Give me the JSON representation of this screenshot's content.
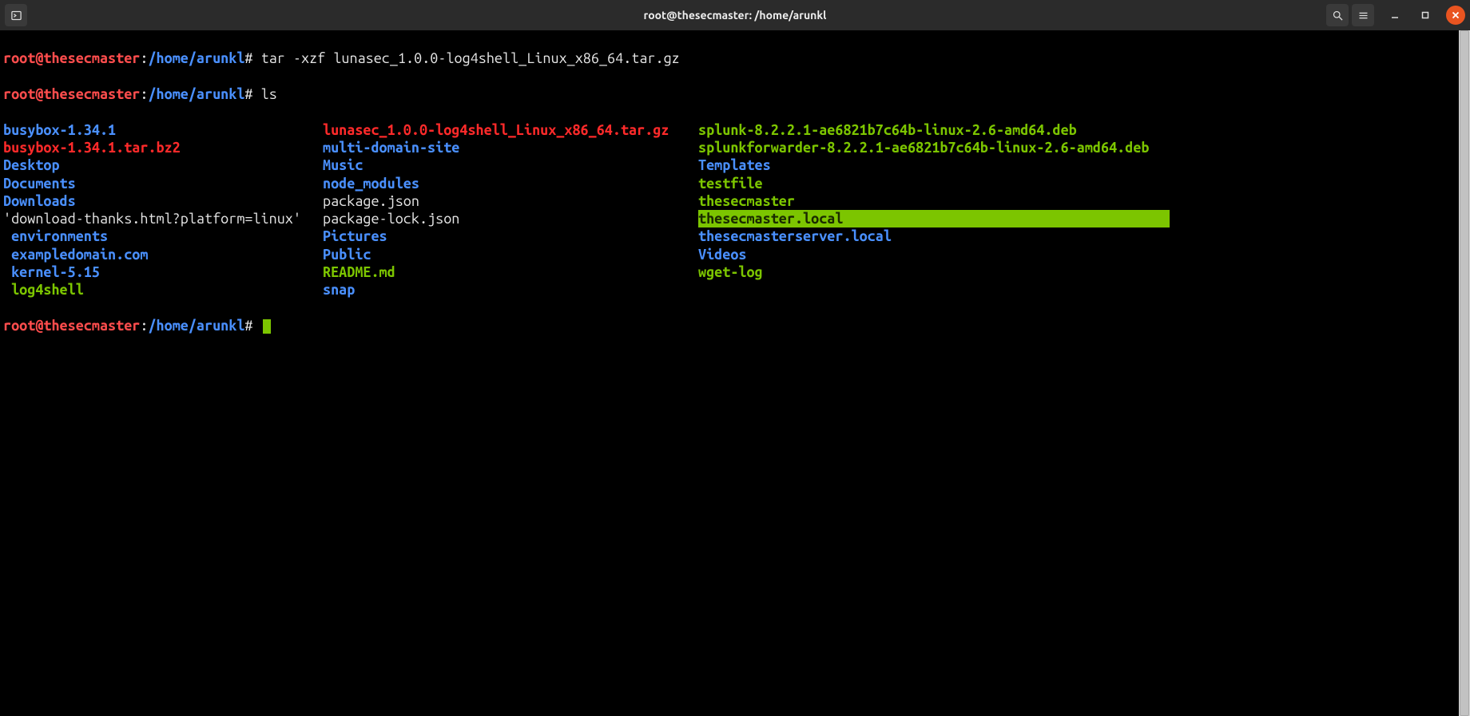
{
  "window": {
    "title": "root@thesecmaster: /home/arunkl"
  },
  "colors": {
    "prompt_user": "#ff4d4d",
    "prompt_path": "#4a90ff",
    "directory": "#4a90ff",
    "executable": "#7cc500",
    "archive": "#ff2a2a",
    "highlight_bg": "#7cc500",
    "close_btn": "#e95420",
    "titlebar_bg": "#2b2b2b",
    "terminal_bg": "#000000"
  },
  "prompt": {
    "user_host": "root@thesecmaster",
    "path": "/home/arunkl",
    "sep1": ":",
    "sigil": "#"
  },
  "history": [
    {
      "cmd": "tar -xzf lunasec_1.0.0-log4shell_Linux_x86_64.tar.gz"
    },
    {
      "cmd": "ls"
    }
  ],
  "ls": {
    "col1": [
      {
        "text": "busybox-1.34.1",
        "class": "dir"
      },
      {
        "text": "busybox-1.34.1.tar.bz2",
        "class": "arch"
      },
      {
        "text": "Desktop",
        "class": "dir"
      },
      {
        "text": "Documents",
        "class": "dir"
      },
      {
        "text": "Downloads",
        "class": "dir"
      },
      {
        "text": "'download-thanks.html?platform=linux'",
        "class": "reg"
      },
      {
        "text": " environments",
        "class": "dir"
      },
      {
        "text": " exampledomain.com",
        "class": "dir"
      },
      {
        "text": " kernel-5.15",
        "class": "dir"
      },
      {
        "text": " log4shell",
        "class": "exe"
      }
    ],
    "col2": [
      {
        "text": "lunasec_1.0.0-log4shell_Linux_x86_64.tar.gz",
        "class": "arch"
      },
      {
        "text": "multi-domain-site",
        "class": "dir"
      },
      {
        "text": "Music",
        "class": "dir"
      },
      {
        "text": "node_modules",
        "class": "dir"
      },
      {
        "text": "package.json",
        "class": "reg"
      },
      {
        "text": "package-lock.json",
        "class": "reg"
      },
      {
        "text": "Pictures",
        "class": "dir"
      },
      {
        "text": "Public",
        "class": "dir"
      },
      {
        "text": "README.md",
        "class": "str"
      },
      {
        "text": "snap",
        "class": "dir"
      }
    ],
    "col3": [
      {
        "text": "splunk-8.2.2.1-ae6821b7c64b-linux-2.6-amd64.deb",
        "class": "exe"
      },
      {
        "text": "splunkforwarder-8.2.2.1-ae6821b7c64b-linux-2.6-amd64.deb",
        "class": "exe"
      },
      {
        "text": "Templates",
        "class": "dir"
      },
      {
        "text": "testfile",
        "class": "exe"
      },
      {
        "text": "thesecmaster",
        "class": "exe"
      },
      {
        "text": "thesecmaster.local",
        "class": "hl"
      },
      {
        "text": "thesecmasterserver.local",
        "class": "dir"
      },
      {
        "text": "Videos",
        "class": "dir"
      },
      {
        "text": "wget-log",
        "class": "exe"
      }
    ]
  }
}
